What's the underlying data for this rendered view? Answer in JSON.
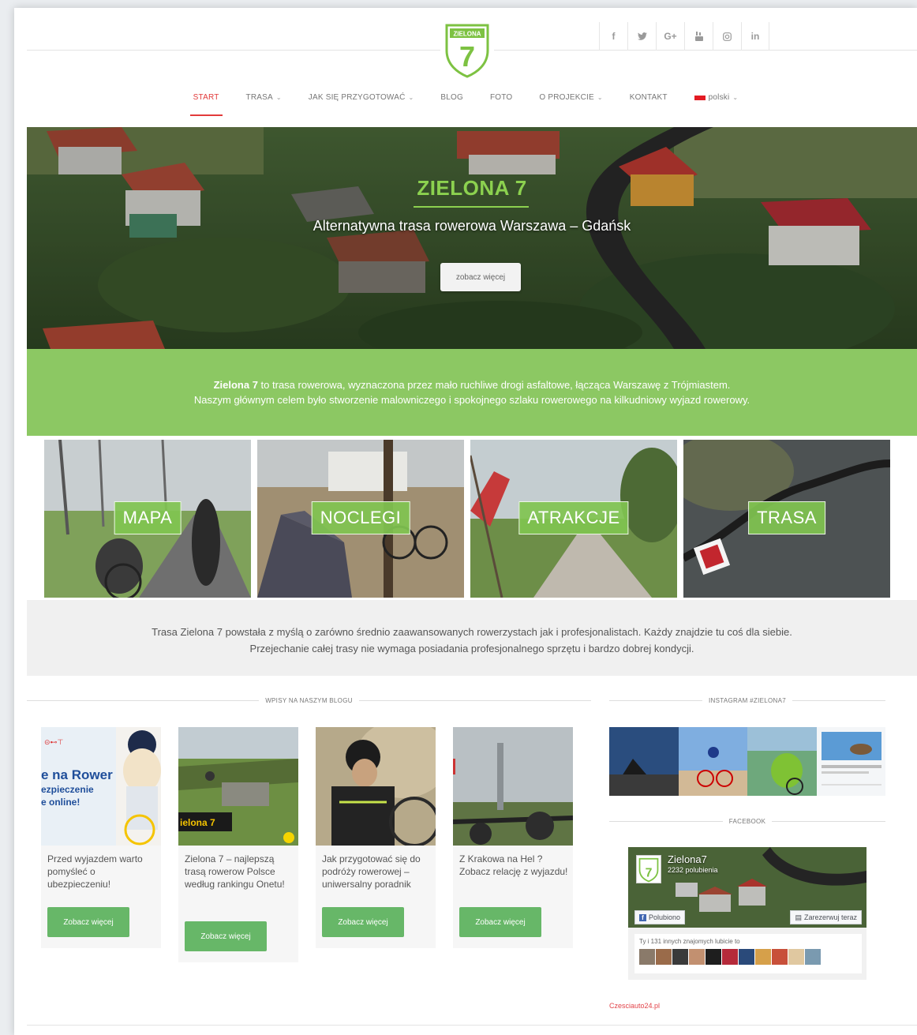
{
  "logo": {
    "text": "ZIELONA",
    "number": "7"
  },
  "social": [
    {
      "name": "facebook-icon",
      "glyph": "f"
    },
    {
      "name": "twitter-icon",
      "glyph": "🐦"
    },
    {
      "name": "google-plus-icon",
      "glyph": "G+"
    },
    {
      "name": "youtube-icon",
      "glyph": "▶"
    },
    {
      "name": "instagram-icon",
      "glyph": "◎"
    },
    {
      "name": "linkedin-icon",
      "glyph": "in"
    }
  ],
  "nav": {
    "start": "START",
    "trasa": "TRASA",
    "jak": "JAK SIĘ PRZYGOTOWAĆ",
    "blog": "BLOG",
    "foto": "FOTO",
    "projekt": "O PROJEKCIE",
    "kontakt": "KONTAKT",
    "lang": "polski",
    "chevron": "⌄"
  },
  "hero": {
    "title": "ZIELONA 7",
    "subtitle": "Alternatywna  trasa rowerowa  Warszawa – Gdańsk",
    "button": "zobacz więcej"
  },
  "intro": {
    "bold": "Zielona 7",
    "line1": " to trasa rowerowa, wyznaczona przez mało ruchliwe drogi asfaltowe, łącząca Warszawę z Trójmiastem.",
    "line2": "Naszym głównym celem było stworzenie malowniczego i spokojnego szlaku rowerowego na kilkudniowy wyjazd rowerowy."
  },
  "tiles": [
    "MAPA",
    "NOCLEGI",
    "ATRAKCJE",
    "TRASA"
  ],
  "about": {
    "line1": "Trasa Zielona 7 powstała z myślą o zarówno średnio zaawansowanych rowerzystach jak i profesjonalistach. Każdy znajdzie tu coś dla siebie.",
    "line2": "Przejechanie całej trasy nie wymaga posiadania profesjonalnego sprzętu i bardzo dobrej kondycji."
  },
  "sections": {
    "blog": "WPISY NA NASZYM BLOGU",
    "instagram": "INSTAGRAM #ZIELONA7",
    "facebook": "FACEBOOK"
  },
  "posts": [
    {
      "title": "Przed wyjazdem warto pomyśleć o ubezpieczeniu!",
      "button": "Zobacz więcej",
      "overlay": "e na Rower",
      "overlay2": "ezpieczenie",
      "overlay3": "e online!"
    },
    {
      "title": "Zielona 7 – najlepszą trasą rowerow Polsce według rankingu Onetu!",
      "button": "Zobacz więcej",
      "overlay": "ielona 7"
    },
    {
      "title": "Jak przygotować się do podróży rowerowej – uniwersalny poradnik",
      "button": "Zobacz więcej"
    },
    {
      "title": "Z Krakowa na Hel ? Zobacz relację z wyjazdu!",
      "button": "Zobacz więcej"
    }
  ],
  "facebook": {
    "name": "Zielona7",
    "likes": "2232 polubienia",
    "like_button": "Polubiono",
    "book_button": "Zarezerwuj teraz",
    "friends_text": "Ty i 131 innych znajomych lubicie to"
  },
  "footer_link": "Czesciauto24.pl",
  "colors": {
    "green": "#8cc863",
    "accent": "#e23b3b",
    "button_green": "#67b768",
    "title_green": "#8cd14f"
  }
}
